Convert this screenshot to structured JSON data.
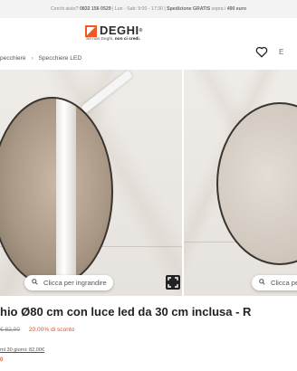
{
  "topbar": {
    "help_text": "Cerchi aiuto?",
    "phone": "0832 156 0529",
    "hours": "| Lun - Sab: 9:00 - 17:30 |",
    "shipping_bold": "Spedizione GRATIS",
    "shipping_rest": "sopra i",
    "threshold": "490 euro"
  },
  "header": {
    "brand": "DEGHI",
    "tagline_prefix": "Se non Deghi,",
    "tagline_bold": "non ci credi.",
    "wishlist_icon": "heart-icon",
    "extra_label": "E"
  },
  "breadcrumb": {
    "items": [
      "pecchiere",
      "Specchiere LED"
    ]
  },
  "gallery": {
    "zoom_label": "Clicca per ingrandire",
    "zoom_label_2": "Clicca pe"
  },
  "product": {
    "title": "hio Ø80 cm con luce led da 30 cm inclusa - R",
    "old_price": "€ 82,00",
    "discount": "20,00% di sconto",
    "lowest_price_note": "ml 30 giorni: 82,00€",
    "status": "0"
  },
  "colors": {
    "brand_orange": "#f05a22",
    "discount_red": "#d9532c"
  }
}
